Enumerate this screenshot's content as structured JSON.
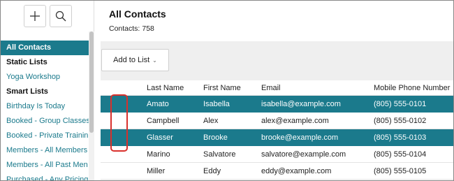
{
  "sidebar": {
    "tools": [
      {
        "name": "plus-icon"
      },
      {
        "name": "search-icon"
      }
    ],
    "items": [
      {
        "label": "All Contacts",
        "kind": "active"
      },
      {
        "label": "Static Lists",
        "kind": "heading"
      },
      {
        "label": "Yoga Workshop",
        "kind": "link"
      },
      {
        "label": "Smart Lists",
        "kind": "heading"
      },
      {
        "label": "Birthday Is Today",
        "kind": "link"
      },
      {
        "label": "Booked - Group Classes",
        "kind": "link"
      },
      {
        "label": "Booked - Private Trainin",
        "kind": "link"
      },
      {
        "label": "Members - All Members",
        "kind": "link"
      },
      {
        "label": "Members - All Past Men",
        "kind": "link"
      },
      {
        "label": "Purchased - Any Pricing",
        "kind": "link"
      }
    ]
  },
  "main": {
    "title": "All Contacts",
    "count_label": "Contacts:",
    "count_value": "758",
    "add_to_list_label": "Add to List",
    "columns": {
      "last": "Last Name",
      "first": "First Name",
      "email": "Email",
      "phone": "Mobile Phone Number"
    },
    "rows": [
      {
        "last": "Amato",
        "first": "Isabella",
        "email": "isabella@example.com",
        "phone": "(805) 555-0101",
        "checked": true
      },
      {
        "last": "Campbell",
        "first": "Alex",
        "email": "alex@example.com",
        "phone": "(805) 555-0102",
        "checked": false
      },
      {
        "last": "Glasser",
        "first": "Brooke",
        "email": "brooke@example.com",
        "phone": "(805) 555-0103",
        "checked": true
      },
      {
        "last": "Marino",
        "first": "Salvatore",
        "email": "salvatore@example.com",
        "phone": "(805) 555-0104",
        "checked": false
      },
      {
        "last": "Miller",
        "first": "Eddy",
        "email": "eddy@example.com",
        "phone": "(805) 555-0105",
        "checked": false
      }
    ]
  },
  "colors": {
    "accent": "#1b7a8c",
    "highlight": "#d9302c"
  }
}
